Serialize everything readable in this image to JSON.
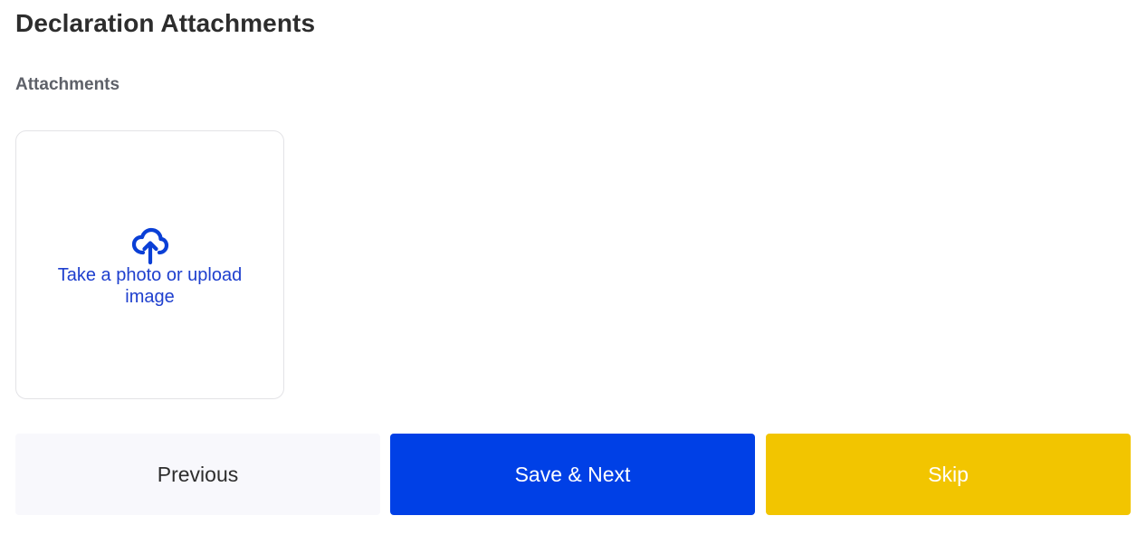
{
  "page": {
    "title": "Declaration Attachments"
  },
  "attachments": {
    "label": "Attachments",
    "upload_tile": {
      "icon": "cloud-upload-icon",
      "text": "Take a photo or upload image"
    }
  },
  "actions": {
    "previous_label": "Previous",
    "save_next_label": "Save & Next",
    "skip_label": "Skip"
  },
  "colors": {
    "primary": "#0040e6",
    "skip": "#f2c500",
    "previous_bg": "#f8f8fc",
    "upload_text": "#1e3fce"
  }
}
